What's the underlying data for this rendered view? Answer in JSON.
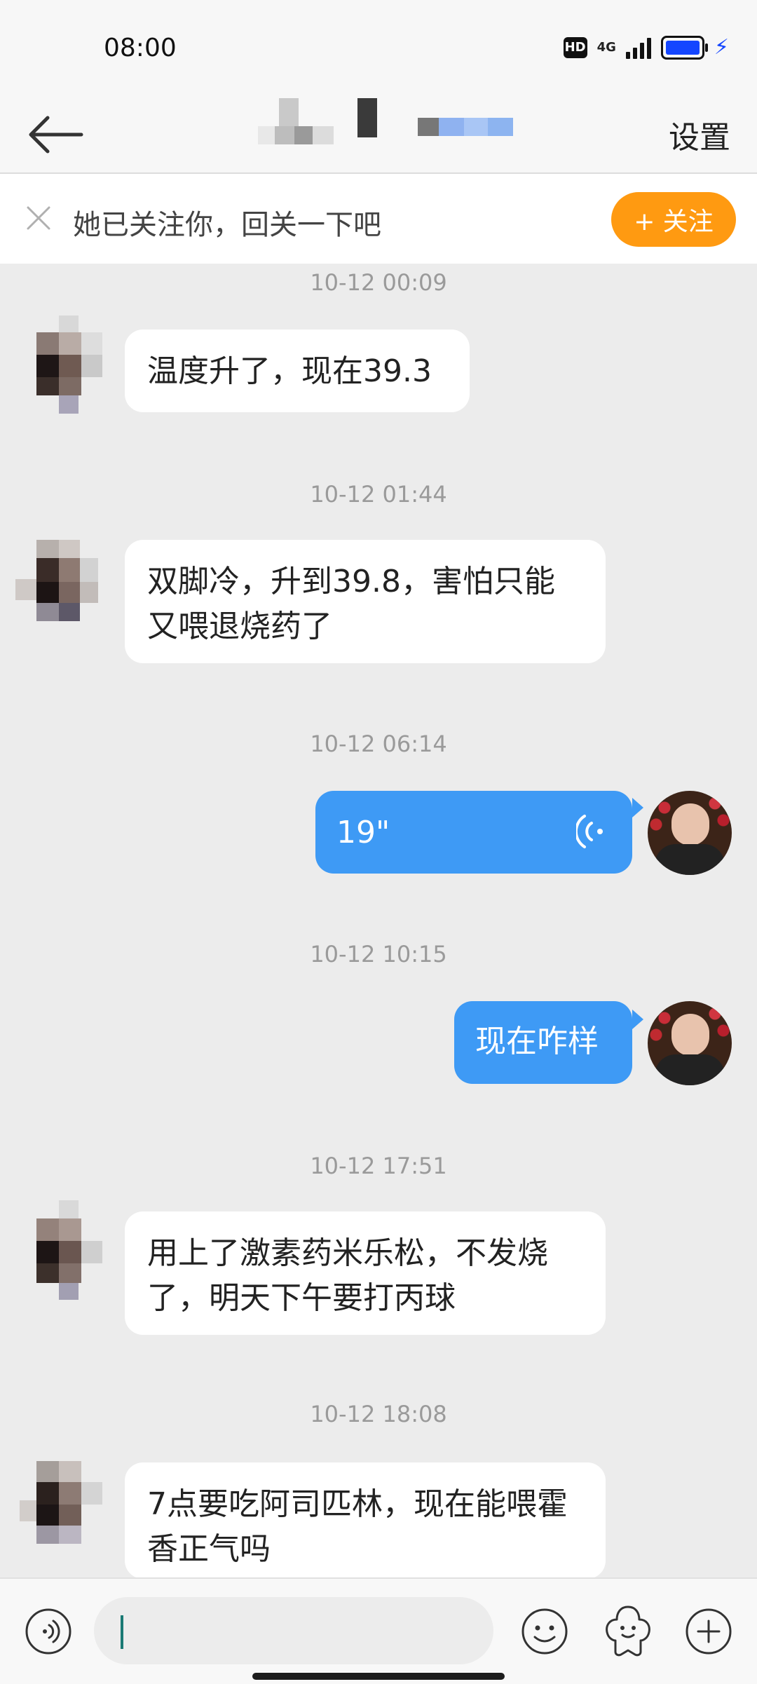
{
  "status": {
    "time": "08:00",
    "hd_badge": "HD",
    "network": "4G"
  },
  "header": {
    "back_label": "",
    "title": "",
    "settings_label": "设置"
  },
  "follow_bar": {
    "text": "她已关注你，回关一下吧",
    "button_label": "+ 关注"
  },
  "messages": [
    {
      "timestamp": "10-12 00:09",
      "side": "left",
      "text": "温度升了，现在39.3"
    },
    {
      "timestamp": "10-12 01:44",
      "side": "left",
      "text": "双脚冷，升到39.8，害怕只能又喂退烧药了"
    },
    {
      "timestamp": "10-12 06:14",
      "side": "right",
      "type": "voice",
      "text": "19\""
    },
    {
      "timestamp": "10-12 10:15",
      "side": "right",
      "text": "现在咋样"
    },
    {
      "timestamp": "10-12 17:51",
      "side": "left",
      "text": "用上了激素药米乐松，不发烧了，明天下午要打丙球"
    },
    {
      "timestamp": "10-12 18:08",
      "side": "left",
      "text": "7点要吃阿司匹林，现在能喂霍香正气吗"
    }
  ],
  "input": {
    "placeholder": ""
  },
  "colors": {
    "accent_orange": "#ff9a11",
    "bubble_blue": "#3e9af5",
    "battery": "#1446ff"
  }
}
